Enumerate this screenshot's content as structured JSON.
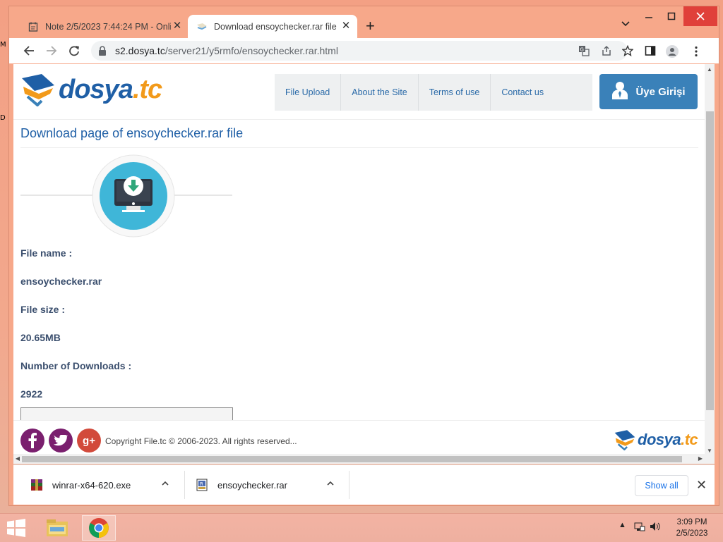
{
  "desktop": {
    "left_edge_text": "M\nD"
  },
  "browser": {
    "tabs": [
      {
        "title": "Note 2/5/2023 7:44:24 PM - Onli",
        "active": false
      },
      {
        "title": "Download ensoychecker.rar file",
        "active": true
      }
    ],
    "url_host": "s2.dosya.tc",
    "url_path": "/server21/y5rmfo/ensoychecker.rar.html"
  },
  "site": {
    "logo_main": "dosya",
    "logo_tld": ".tc",
    "menu": [
      "File Upload",
      "About the Site",
      "Terms of use",
      "Contact us"
    ],
    "login_label": "Üye Girişi",
    "page_title": "Download page of ensoychecker.rar file",
    "file_name_label": "File name :",
    "file_name": "ensoychecker.rar",
    "file_size_label": "File size :",
    "file_size": "20.65MB",
    "downloads_label": "Number of Downloads :",
    "downloads_count": "2922",
    "copyright": "Copyright File.tc © 2006-2023. All rights reserved..."
  },
  "download_bar": {
    "items": [
      {
        "name": "winrar-x64-620.exe",
        "icon": "winrar-exe-icon"
      },
      {
        "name": "ensoychecker.rar",
        "icon": "rar-archive-icon"
      }
    ],
    "show_all": "Show all"
  },
  "taskbar": {
    "time": "3:09 PM",
    "date": "2/5/2023"
  },
  "colors": {
    "brand_blue": "#1f5fa6",
    "brand_orange": "#f29a1a",
    "login_bg": "#3a81b9"
  }
}
